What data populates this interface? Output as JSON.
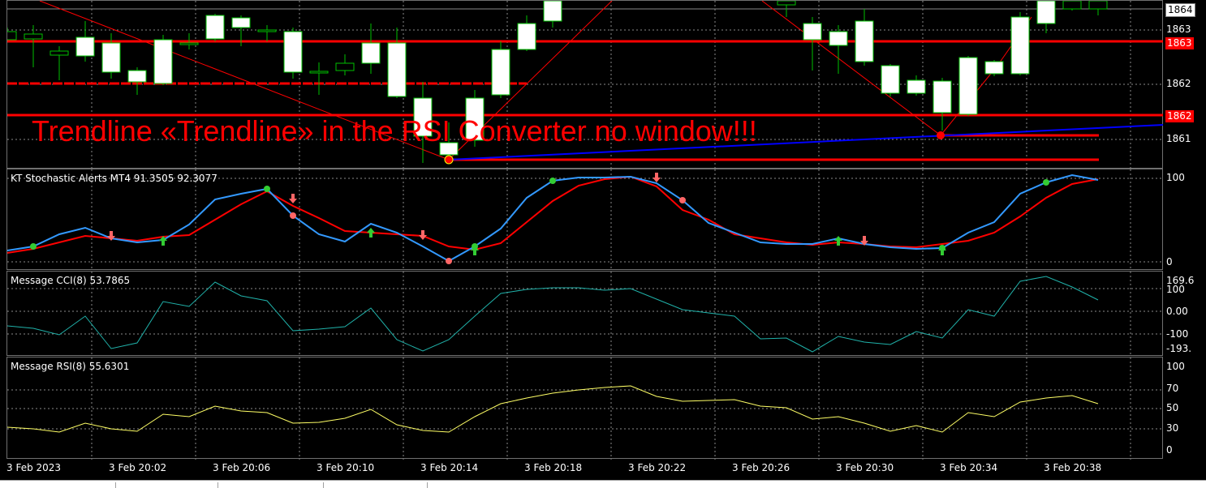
{
  "colors": {
    "background": "#000000",
    "bull_candle": "#ffffff",
    "candle_outline": "#00c000",
    "level_line": "#ff0000",
    "blue_trend": "#0000ff",
    "stoch_main": "#3399ff",
    "stoch_signal": "#ff0000",
    "cci_line": "#20b2aa",
    "rsi_line": "#ffff66",
    "grid": "#8a8a8a"
  },
  "main_chart": {
    "price_labels": [
      "1864",
      "1863",
      "1863",
      "1862",
      "1862",
      "1861"
    ],
    "warning_text": "Trendline «Trendline» in the RSI Converter no window!!!"
  },
  "stochastic": {
    "title": "KT Stochastic Alerts MT4 91.3505 92.3077",
    "levels": [
      "100",
      "0"
    ]
  },
  "cci": {
    "title": "Message CCI(8) 53.7865",
    "levels": [
      "169.6",
      "100",
      "0.00",
      "-100",
      "-193."
    ]
  },
  "rsi": {
    "title": "Message RSI(8) 55.6301",
    "levels": [
      "100",
      "70",
      "50",
      "30",
      "0"
    ]
  },
  "time_axis": [
    "3 Feb 2023",
    "3 Feb 20:02",
    "3 Feb 20:06",
    "3 Feb 20:10",
    "3 Feb 20:14",
    "3 Feb 20:18",
    "3 Feb 20:22",
    "3 Feb 20:26",
    "3 Feb 20:30",
    "3 Feb 20:34",
    "3 Feb 20:38"
  ]
}
